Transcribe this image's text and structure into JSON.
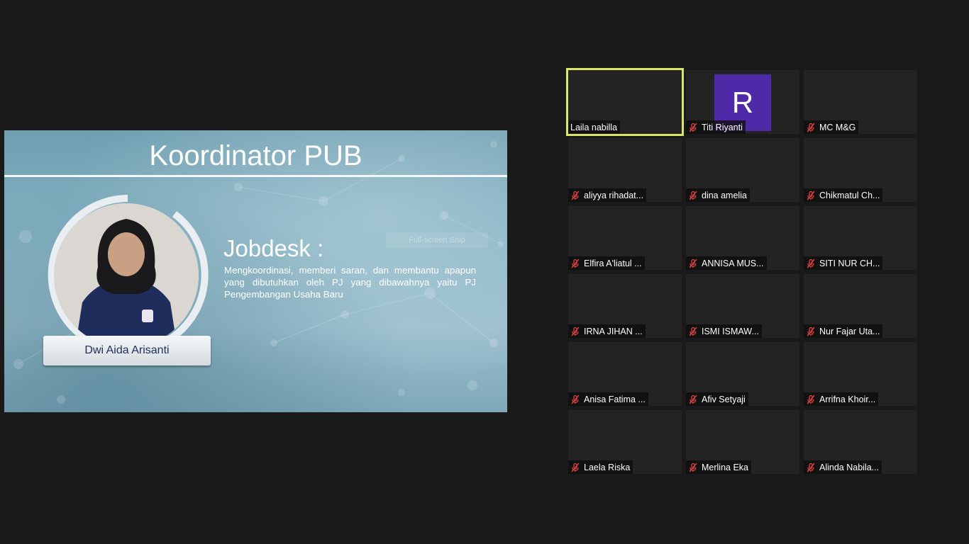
{
  "slide": {
    "title": "Koordinator PUB",
    "person_name": "Dwi Aida Arisanti",
    "jobdesk_heading": "Jobdesk :",
    "jobdesk_text": "Mengkoordinasi, memberi saran, dan membantu apapun yang dibutuhkan oleh PJ yang dibawahnya yaitu PJ Pengembangan Usaha Baru",
    "overlay_hint": "Full-screen Snip"
  },
  "colors": {
    "active_border": "#d6e66a",
    "avatar_bg": "#4f2aa8",
    "muted_mic": "#e04040"
  },
  "participants": [
    {
      "name": "Laila nabilla",
      "muted": false,
      "active": true
    },
    {
      "name": "Titi Riyanti",
      "muted": true,
      "avatar_letter": "R"
    },
    {
      "name": "MC M&G",
      "muted": true
    },
    {
      "name": "aliyya rihadat...",
      "muted": true
    },
    {
      "name": "dina amelia",
      "muted": true
    },
    {
      "name": "Chikmatul Ch...",
      "muted": true
    },
    {
      "name": "Elfira A'liatul ...",
      "muted": true
    },
    {
      "name": "ANNISA MUS...",
      "muted": true
    },
    {
      "name": "SITI NUR CH...",
      "muted": true
    },
    {
      "name": "IRNA JIHAN ...",
      "muted": true
    },
    {
      "name": "ISMI ISMAW...",
      "muted": true
    },
    {
      "name": "Nur Fajar Uta...",
      "muted": true
    },
    {
      "name": "Anisa Fatima ...",
      "muted": true
    },
    {
      "name": "Afiv Setyaji",
      "muted": true
    },
    {
      "name": "Arrifna Khoir...",
      "muted": true
    },
    {
      "name": "Laela Riska",
      "muted": true
    },
    {
      "name": "Merlina Eka",
      "muted": true
    },
    {
      "name": "Alinda Nabila...",
      "muted": true
    }
  ]
}
